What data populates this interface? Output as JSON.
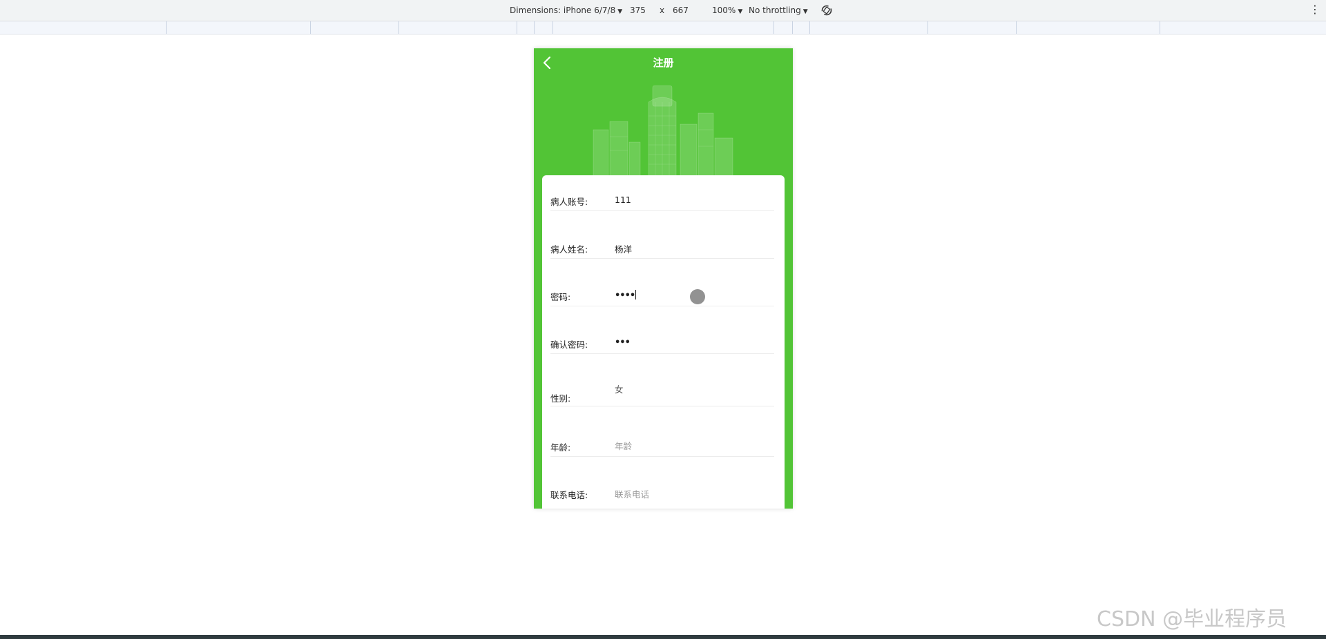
{
  "devtools": {
    "dimensions_label": "Dimensions: iPhone 6/7/8",
    "width": "375",
    "times": "x",
    "height": "667",
    "zoom": "100%",
    "throttling": "No throttling",
    "caret": "▼",
    "kebab": "⋮"
  },
  "app": {
    "title": "注册",
    "back_icon": "chevron-left-icon",
    "theme_color": "#52c436"
  },
  "form": {
    "fields": [
      {
        "label": "病人账号:",
        "value": "111",
        "placeholder": ""
      },
      {
        "label": "病人姓名:",
        "value": "杨洋",
        "placeholder": ""
      },
      {
        "label": "密码:",
        "value": "••••",
        "placeholder": ""
      },
      {
        "label": "确认密码:",
        "value": "•••",
        "placeholder": ""
      },
      {
        "label": "性别:",
        "value": "女",
        "placeholder": ""
      },
      {
        "label": "年龄:",
        "value": "",
        "placeholder": "年龄"
      },
      {
        "label": "联系电话:",
        "value": "",
        "placeholder": "联系电话"
      }
    ]
  },
  "watermark": "CSDN @毕业程序员"
}
